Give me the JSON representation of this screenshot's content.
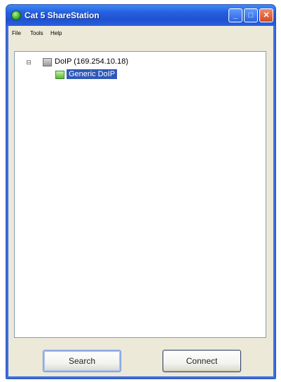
{
  "window": {
    "title": "Cat 5 ShareStation",
    "controls": {
      "minimize": "_",
      "maximize": "□",
      "close": "✕"
    }
  },
  "menu": {
    "items": [
      "File",
      "Tools",
      "Help"
    ]
  },
  "tree": {
    "expander": "⊟",
    "parent": {
      "label": "DoIP (169.254.10.18)",
      "icon": "device-icon"
    },
    "child": {
      "label": "Generic DoIP",
      "icon": "connected-node-icon",
      "selected": true
    }
  },
  "buttons": {
    "search": "Search",
    "connect": "Connect"
  },
  "colors": {
    "titlebar": "#2660e0",
    "selection": "#2f58b8",
    "window_bg": "#ece9d8"
  }
}
